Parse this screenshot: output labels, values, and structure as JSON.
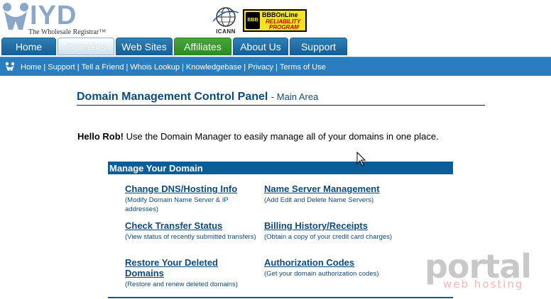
{
  "brand": {
    "logo_text": "IYD",
    "tagline": "The Wholesale Registrar™"
  },
  "badges": {
    "icann_label": "ICANN",
    "bbb_line1": "BBBOnLine",
    "bbb_line2": "RELIABILITY",
    "bbb_line3": "PROGRAM",
    "bbb_seal": "BBB"
  },
  "tabs": [
    {
      "label": "Home",
      "state": "normal"
    },
    {
      "label": "Domains",
      "state": "active"
    },
    {
      "label": "Web Sites",
      "state": "normal"
    },
    {
      "label": "Affiliates",
      "state": "highlight"
    },
    {
      "label": "About Us",
      "state": "normal"
    },
    {
      "label": "Support",
      "state": "normal"
    }
  ],
  "nav": {
    "links": [
      "Home",
      "Support",
      "Tell a Friend",
      "Whois Lookup",
      "Knowledgebase",
      "Privacy",
      "Terms of Use"
    ],
    "separator": "|"
  },
  "page": {
    "title": "Domain Management Control Panel",
    "subtitle": "- Main Area",
    "greeting_name": "Hello Rob!",
    "greeting_text": " Use the Domain Manager to easily manage all of your domains in one place."
  },
  "panel": {
    "heading": "Manage Your Domain",
    "items": [
      {
        "label": "Change DNS/Hosting Info",
        "desc": "(Modify Domain Name Server & IP addresses)"
      },
      {
        "label": "Name Server Management",
        "desc": "(Add Edit and Delete Name Servers)"
      },
      {
        "label": "Check Transfer Status",
        "desc": "(View status of recently submitted transfers)"
      },
      {
        "label": "Billing History/Receipts",
        "desc": "(Obtain a copy of your credit card charges)"
      },
      {
        "label": "Restore Your Deleted Domains",
        "desc": "(Restore and renew deleted domains)"
      },
      {
        "label": "Authorization Codes",
        "desc": "(Get your domain authorization codes)"
      }
    ]
  },
  "watermark": {
    "main": "portal",
    "sub": "web hosting"
  },
  "colors": {
    "tab_blue": "#2a7ec0",
    "tab_green": "#3e9a31",
    "link_blue": "#104a7a",
    "panel_head": "#0b5d98"
  }
}
